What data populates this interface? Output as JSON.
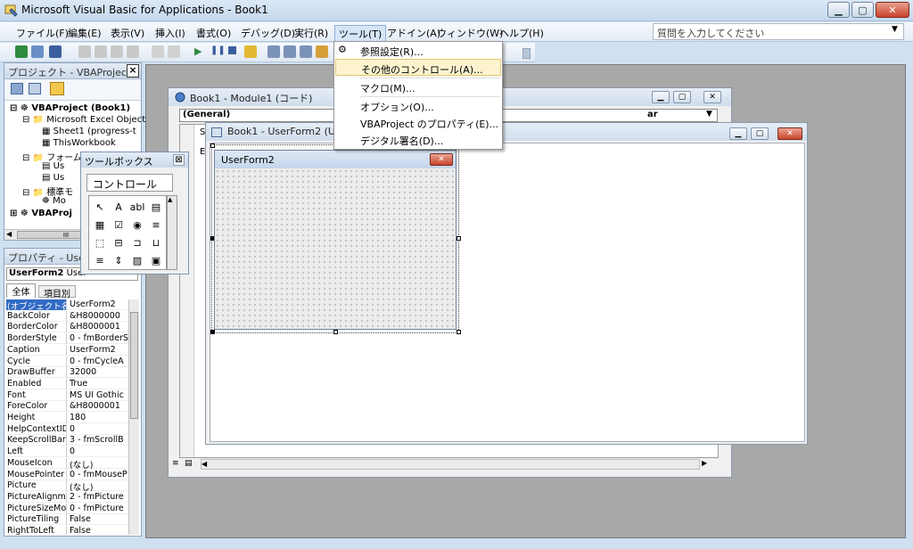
{
  "window": {
    "title": "Microsoft Visual Basic for Applications - Book1",
    "minimize": "▁",
    "maximize": "▢",
    "close": "✕"
  },
  "menu": {
    "items": [
      "ファイル(F)",
      "編集(E)",
      "表示(V)",
      "挿入(I)",
      "書式(O)",
      "デバッグ(D)",
      "実行(R)",
      "ツール(T)",
      "アドイン(A)",
      "ウィンドウ(W)",
      "ヘルプ(H)"
    ],
    "help_placeholder": "質問を入力してください"
  },
  "tools_menu": {
    "items": [
      "参照設定(R)...",
      "その他のコントロール(A)...",
      "マクロ(M)...",
      "オプション(O)...",
      "VBAProject のプロパティ(E)...",
      "デジタル署名(D)..."
    ]
  },
  "project_pane": {
    "title": "プロジェクト - VBAProject",
    "close": "×",
    "tree": [
      "VBAProject (Book1)",
      "Microsoft Excel Object",
      "Sheet1 (progress-t",
      "ThisWorkbook",
      "フォーム",
      "Us",
      "Us",
      "標準モ",
      "Mo",
      "VBAProj"
    ],
    "scroll_mid": "III"
  },
  "props_pane": {
    "title": "プロパティ - User",
    "object_name": "UserForm2",
    "object_type": "User",
    "tabs": [
      "全体",
      "項目別"
    ],
    "rows": [
      {
        "name": "(オブジェクト名)",
        "value": "UserForm2"
      },
      {
        "name": "BackColor",
        "value": "&H8000000"
      },
      {
        "name": "BorderColor",
        "value": "&H8000001"
      },
      {
        "name": "BorderStyle",
        "value": "0 - fmBorderS"
      },
      {
        "name": "Caption",
        "value": "UserForm2"
      },
      {
        "name": "Cycle",
        "value": "0 - fmCycleA"
      },
      {
        "name": "DrawBuffer",
        "value": "32000"
      },
      {
        "name": "Enabled",
        "value": "True"
      },
      {
        "name": "Font",
        "value": "MS UI Gothic"
      },
      {
        "name": "ForeColor",
        "value": "&H8000001"
      },
      {
        "name": "Height",
        "value": "180"
      },
      {
        "name": "HelpContextID",
        "value": "0"
      },
      {
        "name": "KeepScrollBars",
        "value": "3 - fmScrollB"
      },
      {
        "name": "Left",
        "value": "0"
      },
      {
        "name": "MouseIcon",
        "value": "(なし)"
      },
      {
        "name": "MousePointer",
        "value": "0 - fmMouseP"
      },
      {
        "name": "Picture",
        "value": "(なし)"
      },
      {
        "name": "PictureAlignme",
        "value": "2 - fmPicture"
      },
      {
        "name": "PictureSizeMoc",
        "value": "0 - fmPicture"
      },
      {
        "name": "PictureTiling",
        "value": "False"
      },
      {
        "name": "RightToLeft",
        "value": "False"
      }
    ]
  },
  "module_window": {
    "title": "Book1 - Module1 (コード)",
    "object_combo": "(General)",
    "proc_combo_tail": "ar",
    "code_frag1": "Su",
    "code_frag2": "E"
  },
  "userform_window": {
    "title": "Book1 - UserForm2 (Use"
  },
  "userform": {
    "caption": "UserForm2",
    "close": "✕"
  },
  "toolbox": {
    "title": "ツールボックス",
    "close": "⊠",
    "tab": "コントロール",
    "tools": [
      "↖",
      "A",
      "abl",
      "▤",
      "▦",
      "☑",
      "◉",
      "≡",
      "⬚",
      "⊟",
      "⊐",
      "⊔",
      "≡",
      "⇕",
      "▨",
      "▣"
    ]
  },
  "colors": {
    "accent": "#3d6db5",
    "grid_bg": "#ececec",
    "mdi_bg": "#a8a8a8",
    "highlight": "#fdf4cf"
  }
}
